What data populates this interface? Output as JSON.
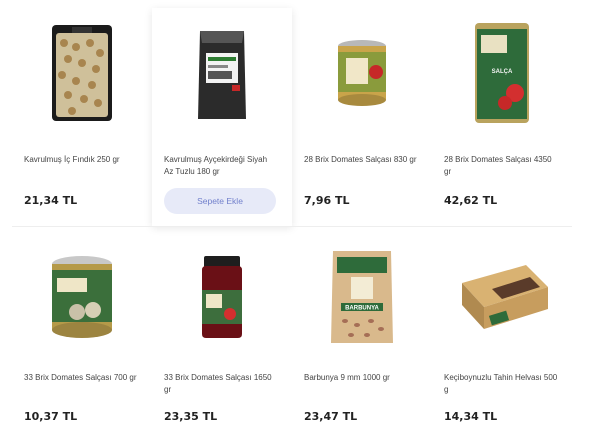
{
  "products": [
    {
      "name": "Kavrulmuş İç Fındık 250 gr",
      "price": "21,34 TL",
      "icon": "hazelnut-bag"
    },
    {
      "name": "Kavrulmuş Ayçekirdeği Siyah Az Tuzlu 180 gr",
      "price": "",
      "icon": "sunflower-seed-bag",
      "add_label": "Sepete Ekle"
    },
    {
      "name": "28 Brix Domates Salçası 830 gr",
      "price": "7,96 TL",
      "icon": "tomato-paste-can"
    },
    {
      "name": "28 Brix Domates Salçası 4350 gr",
      "price": "42,62 TL",
      "icon": "tomato-paste-tin"
    },
    {
      "name": "33 Brix Domates Salçası 700 gr",
      "price": "10,37 TL",
      "icon": "tomato-paste-can-round"
    },
    {
      "name": "33 Brix Domates Salçası 1650 gr",
      "price": "23,35 TL",
      "icon": "tomato-paste-jar"
    },
    {
      "name": "Barbunya 9 mm 1000 gr",
      "price": "23,47 TL",
      "icon": "bean-bag"
    },
    {
      "name": "Keçiboynuzlu Tahin Helvası 500 g",
      "price": "14,34 TL",
      "icon": "halva-box"
    }
  ],
  "colors": {
    "accent": "#7280cc",
    "button_bg": "#e7eaf8",
    "brand_green": "#2e7d32"
  }
}
